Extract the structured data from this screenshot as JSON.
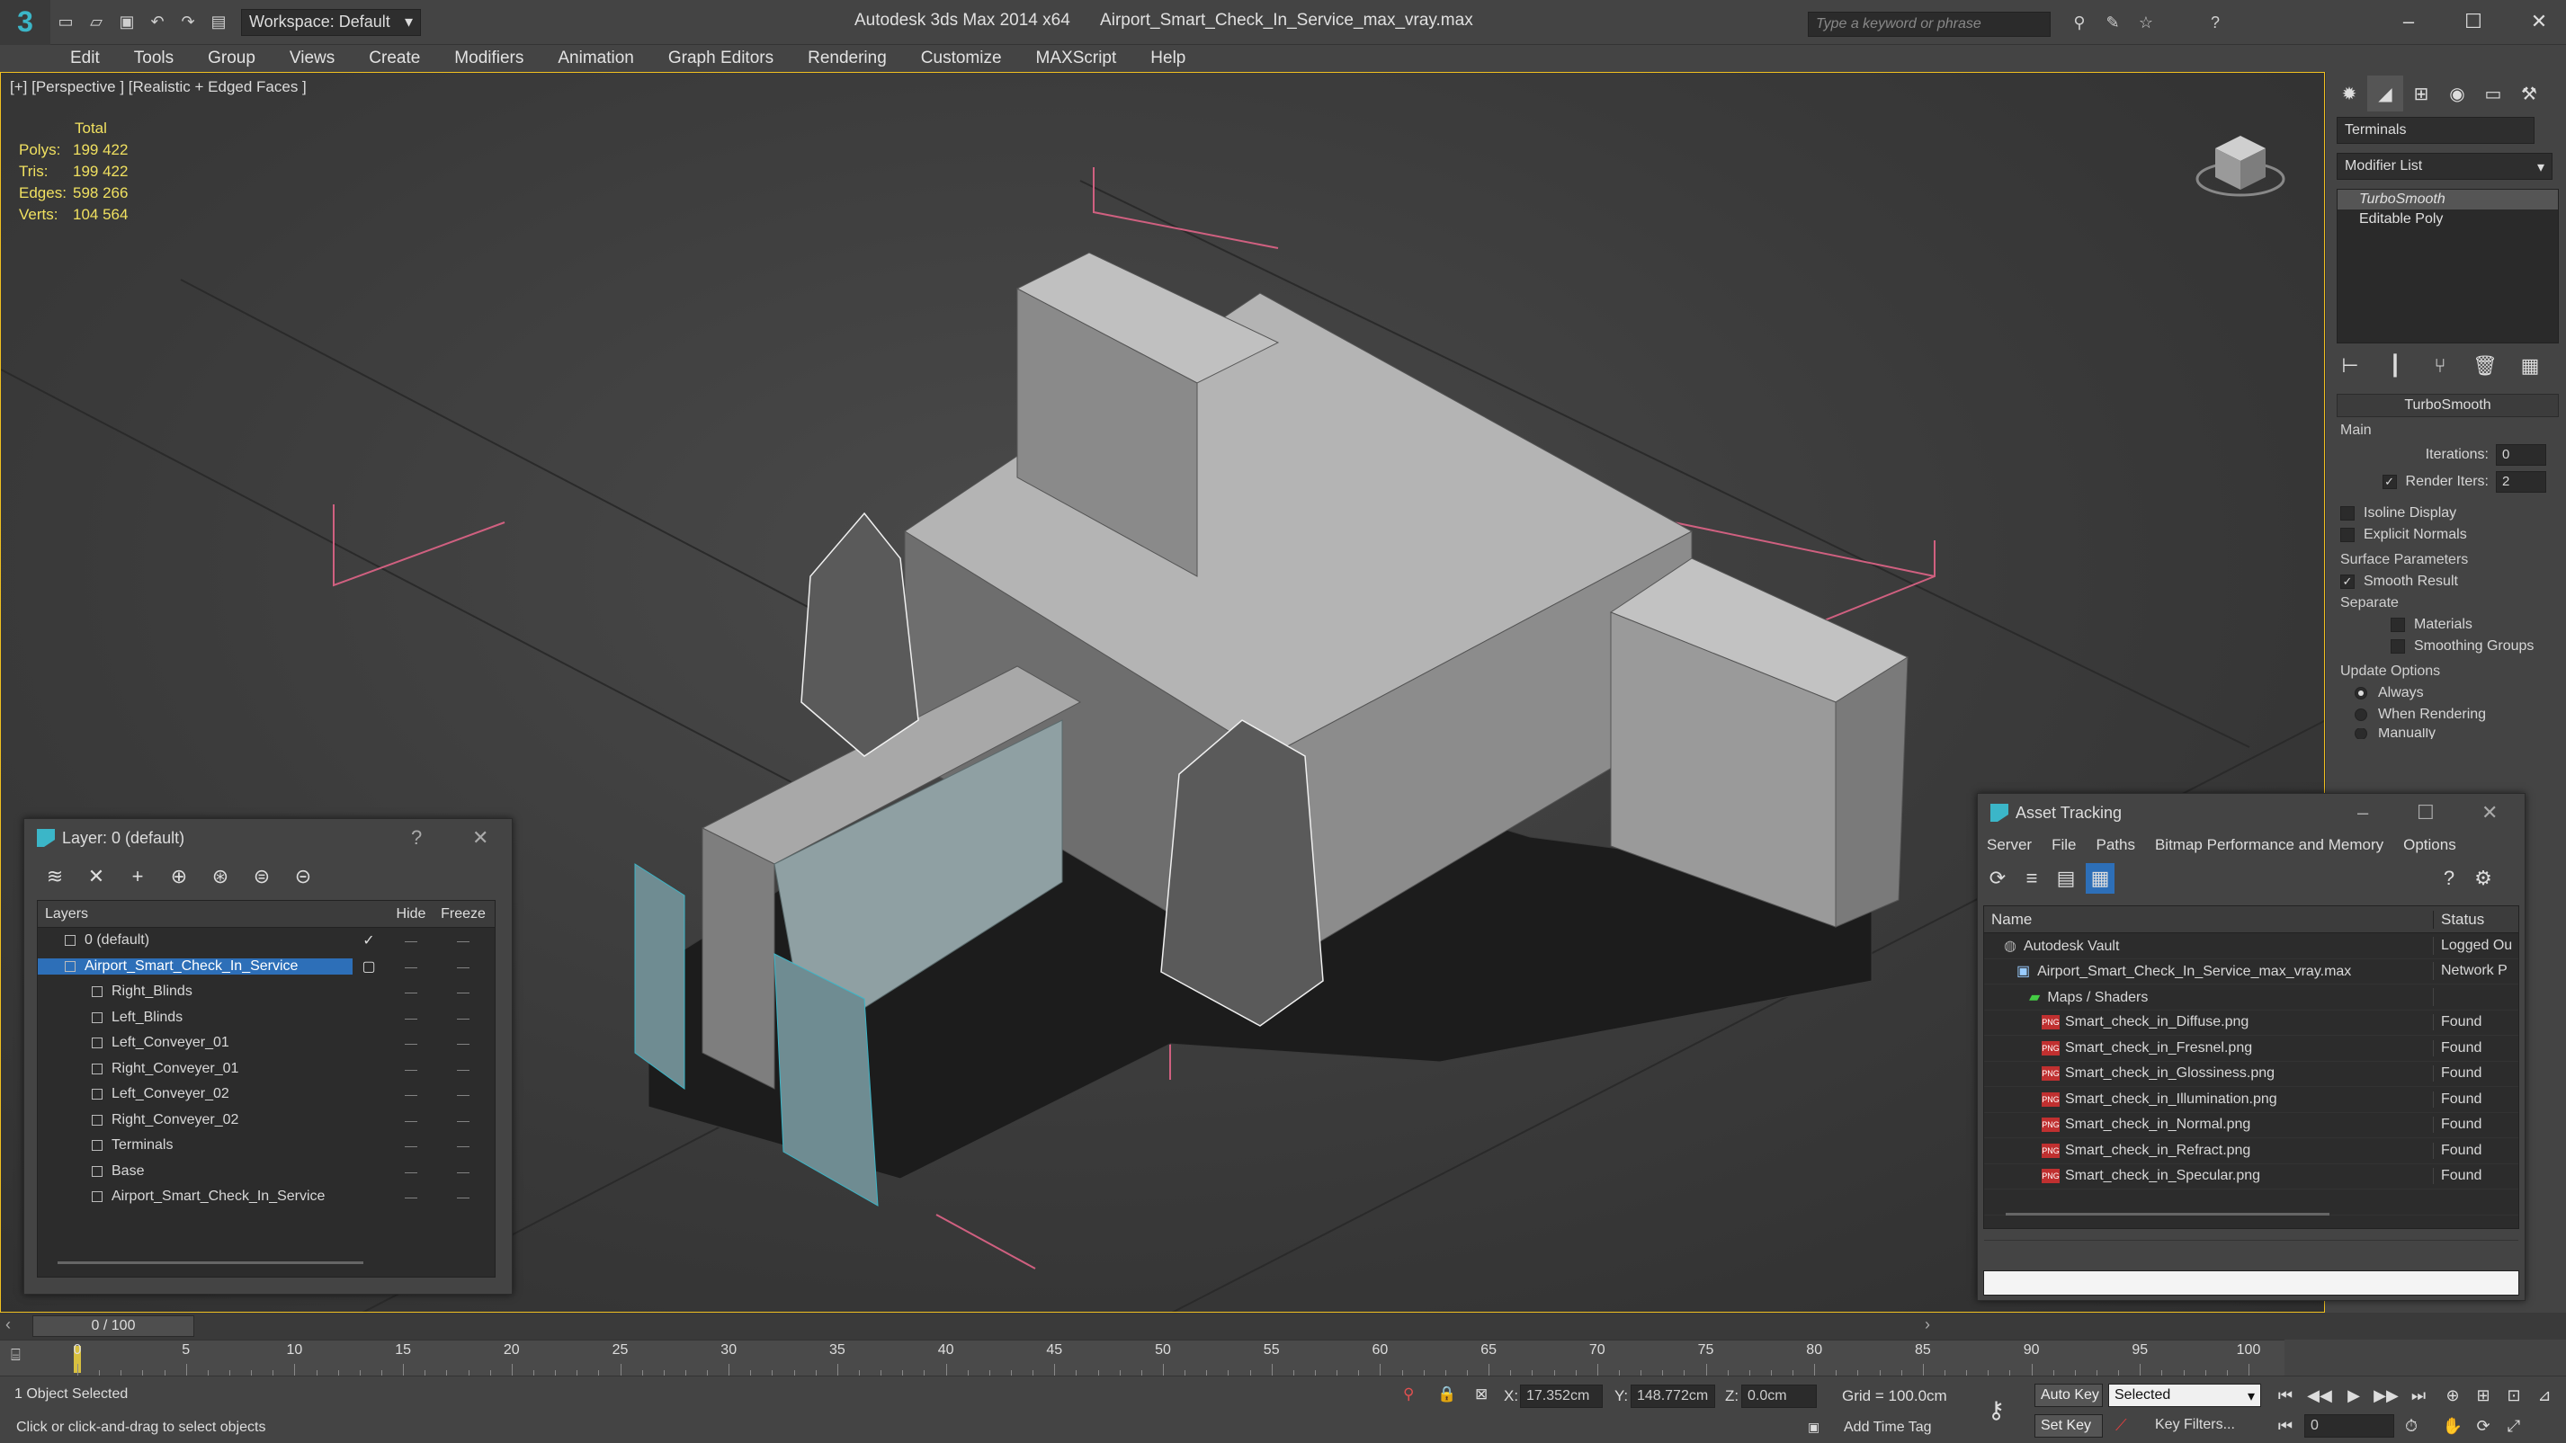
{
  "window": {
    "app_title": "Autodesk 3ds Max  2014 x64",
    "file_title": "Airport_Smart_Check_In_Service_max_vray.max",
    "workspace": "Workspace: Default",
    "search_placeholder": "Type a keyword or phrase"
  },
  "menu": [
    "Edit",
    "Tools",
    "Group",
    "Views",
    "Create",
    "Modifiers",
    "Animation",
    "Graph Editors",
    "Rendering",
    "Customize",
    "MAXScript",
    "Help"
  ],
  "viewport": {
    "label": "[+] [Perspective ] [Realistic + Edged Faces ]",
    "stats_header": "Total",
    "stats": [
      {
        "k": "Polys:",
        "v": "199 422"
      },
      {
        "k": "Tris:",
        "v": "199 422"
      },
      {
        "k": "Edges:",
        "v": "598 266"
      },
      {
        "k": "Verts:",
        "v": "104 564"
      }
    ]
  },
  "command_panel": {
    "object_name": "Terminals",
    "modifier_list": "Modifier List",
    "stack": [
      "TurboSmooth",
      "Editable Poly"
    ],
    "rollout_title": "TurboSmooth",
    "main_label": "Main",
    "iterations_label": "Iterations:",
    "iterations_value": "0",
    "render_iters_label": "Render Iters:",
    "render_iters_value": "2",
    "isoline_label": "Isoline Display",
    "explicit_label": "Explicit Normals",
    "surface_label": "Surface Parameters",
    "smooth_label": "Smooth Result",
    "separate_label": "Separate",
    "materials_label": "Materials",
    "smoothing_groups_label": "Smoothing Groups",
    "update_label": "Update Options",
    "always_label": "Always",
    "when_rendering_label": "When Rendering",
    "manually_label": "Manually"
  },
  "layer_dialog": {
    "title": "Layer: 0 (default)",
    "help": "?",
    "columns": [
      "Layers",
      "Hide",
      "Freeze"
    ],
    "rows": [
      {
        "name": "0 (default)",
        "child": false,
        "selected": false
      },
      {
        "name": "Airport_Smart_Check_In_Service",
        "child": false,
        "selected": true
      },
      {
        "name": "Right_Blinds",
        "child": true,
        "selected": false
      },
      {
        "name": "Left_Blinds",
        "child": true,
        "selected": false
      },
      {
        "name": "Left_Conveyer_01",
        "child": true,
        "selected": false
      },
      {
        "name": "Right_Conveyer_01",
        "child": true,
        "selected": false
      },
      {
        "name": "Left_Conveyer_02",
        "child": true,
        "selected": false
      },
      {
        "name": "Right_Conveyer_02",
        "child": true,
        "selected": false
      },
      {
        "name": "Terminals",
        "child": true,
        "selected": false
      },
      {
        "name": "Base",
        "child": true,
        "selected": false
      },
      {
        "name": "Airport_Smart_Check_In_Service",
        "child": true,
        "selected": false
      }
    ]
  },
  "asset_dialog": {
    "title": "Asset Tracking",
    "menu": [
      "Server",
      "File",
      "Paths",
      "Bitmap Performance and Memory",
      "Options"
    ],
    "columns": [
      "Name",
      "Status"
    ],
    "rows": [
      {
        "name": "Autodesk Vault",
        "status": "Logged Ou",
        "indent": 1
      },
      {
        "name": "Airport_Smart_Check_In_Service_max_vray.max",
        "status": "Network P",
        "indent": 2
      },
      {
        "name": "Maps / Shaders",
        "status": "",
        "indent": 3
      },
      {
        "name": "Smart_check_in_Diffuse.png",
        "status": "Found",
        "indent": 4
      },
      {
        "name": "Smart_check_in_Fresnel.png",
        "status": "Found",
        "indent": 4
      },
      {
        "name": "Smart_check_in_Glossiness.png",
        "status": "Found",
        "indent": 4
      },
      {
        "name": "Smart_check_in_Illumination.png",
        "status": "Found",
        "indent": 4
      },
      {
        "name": "Smart_check_in_Normal.png",
        "status": "Found",
        "indent": 4
      },
      {
        "name": "Smart_check_in_Refract.png",
        "status": "Found",
        "indent": 4
      },
      {
        "name": "Smart_check_in_Specular.png",
        "status": "Found",
        "indent": 4
      }
    ]
  },
  "timeline": {
    "frame_readout": "0 / 100",
    "ticks": [
      "0",
      "5",
      "10",
      "15",
      "20",
      "25",
      "30",
      "35",
      "40",
      "45",
      "50",
      "55",
      "60",
      "65",
      "70",
      "75",
      "80",
      "85",
      "90",
      "95",
      "100"
    ]
  },
  "status": {
    "selection": "1 Object Selected",
    "prompt": "Click or click-and-drag to select objects",
    "x_label": "X:",
    "x_value": "17.352cm",
    "y_label": "Y:",
    "y_value": "148.772cm",
    "z_label": "Z:",
    "z_value": "0.0cm",
    "grid": "Grid = 100.0cm",
    "add_time_tag": "Add Time Tag",
    "auto_key": "Auto Key",
    "set_key": "Set Key",
    "selected_option": "Selected",
    "key_filters": "Key Filters...",
    "frame": "0"
  },
  "colors": {
    "accent": "#3bb6c8",
    "selection": "#2d6fb8",
    "viewport_border": "#f0c020",
    "stats_text": "#f0e060"
  }
}
